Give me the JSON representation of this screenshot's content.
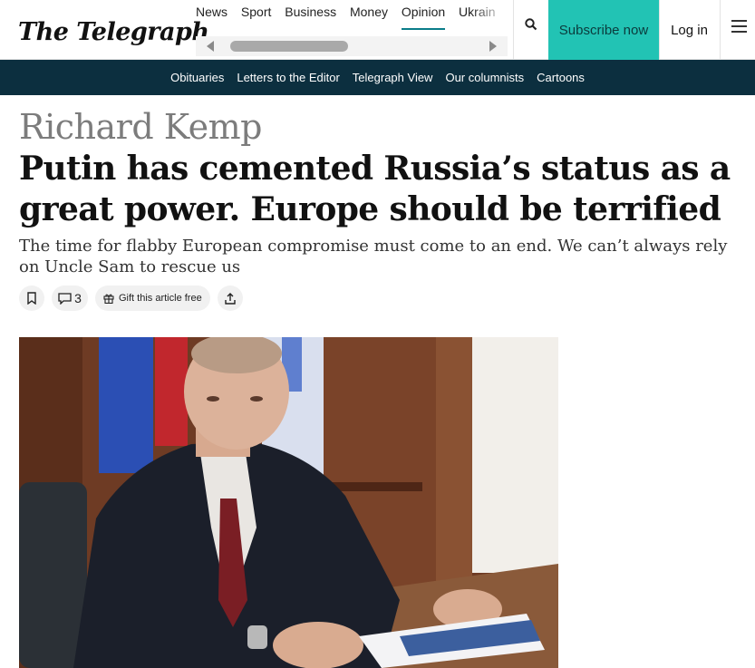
{
  "header": {
    "logo": "The Telegraph",
    "nav_items": [
      "News",
      "Sport",
      "Business",
      "Money",
      "Opinion",
      "Ukrain"
    ],
    "active_nav": "Opinion",
    "subscribe_label": "Subscribe now",
    "login_label": "Log in"
  },
  "subnav": {
    "items": [
      "Obituaries",
      "Letters to the Editor",
      "Telegraph View",
      "Our columnists",
      "Cartoons"
    ]
  },
  "article": {
    "author": "Richard Kemp",
    "headline": "Putin has cemented Russia’s status as a great power. Europe should be terrified",
    "standfirst": "The time for flabby European compromise must come to an end. We can’t always rely on Uncle Sam to rescue us",
    "comments_count": "3",
    "gift_label": "Gift this article free"
  },
  "colors": {
    "subscribe_bg": "#22c3b4",
    "subnav_bg": "#0c2f3f",
    "active_underline": "#0a7d89"
  }
}
